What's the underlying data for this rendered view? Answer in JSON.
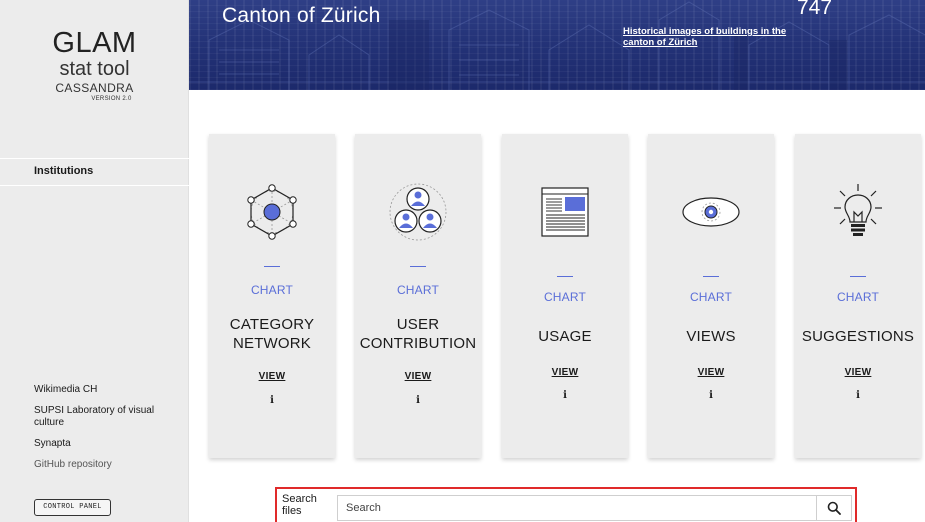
{
  "sidebar": {
    "logo": {
      "line1": "GLAM",
      "line2": "stat tool",
      "line3": "CASSANDRA",
      "version": "VERSION 2.0"
    },
    "section_title": "Institutions",
    "links": [
      "Wikimedia CH",
      "SUPSI Laboratory of visual culture",
      "Synapta",
      "GitHub repository"
    ],
    "control_panel_label": "CONTROL PANEL"
  },
  "banner": {
    "title": "Canton of Zürich",
    "description": "Historical images of buildings in the canton of Zürich",
    "count": "747"
  },
  "cards": [
    {
      "kind": "CHART",
      "name": "CATEGORY NETWORK",
      "view": "VIEW",
      "info": "i",
      "icon": "category-network-icon"
    },
    {
      "kind": "CHART",
      "name": "USER CONTRIBUTION",
      "view": "VIEW",
      "info": "i",
      "icon": "user-contribution-icon"
    },
    {
      "kind": "CHART",
      "name": "USAGE",
      "view": "VIEW",
      "info": "i",
      "icon": "usage-icon"
    },
    {
      "kind": "CHART",
      "name": "VIEWS",
      "view": "VIEW",
      "info": "i",
      "icon": "eye-icon"
    },
    {
      "kind": "CHART",
      "name": "SUGGESTIONS",
      "view": "VIEW",
      "info": "i",
      "icon": "lightbulb-icon"
    }
  ],
  "search": {
    "label": "Search files",
    "placeholder": "Search",
    "value": "",
    "button_icon": "search-icon"
  },
  "colors": {
    "accent": "#5a6ed8",
    "banner": "#243378",
    "highlight": "#e02a2a"
  }
}
